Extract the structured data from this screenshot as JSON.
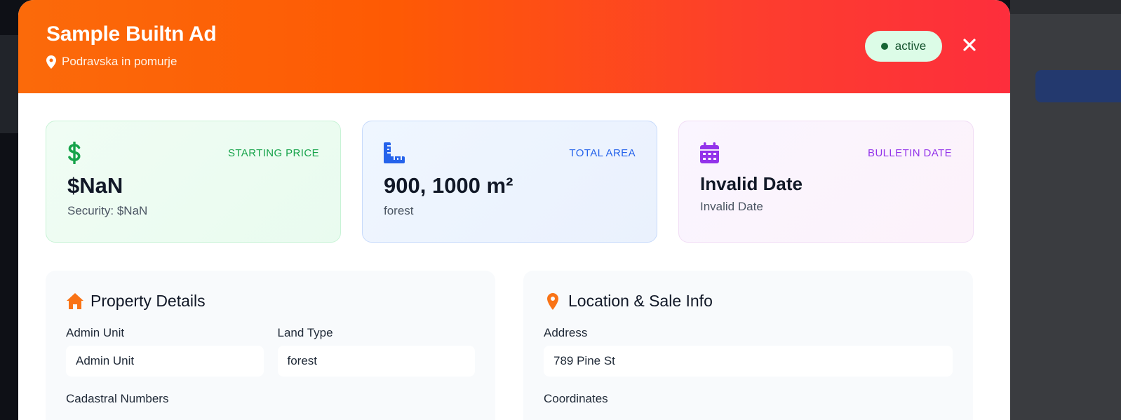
{
  "header": {
    "title": "Sample Builtn Ad",
    "location": "Podravska in pomurje",
    "status": "active",
    "close_icon": "close-icon"
  },
  "stats": [
    {
      "label": "STARTING PRICE",
      "value": "$NaN",
      "sub": "Security: $NaN",
      "icon": "dollar-icon",
      "color": "#16a34a"
    },
    {
      "label": "TOTAL AREA",
      "value": "900, 1000 m²",
      "sub": "forest",
      "icon": "ruler-icon",
      "color": "#2563eb"
    },
    {
      "label": "BULLETIN DATE",
      "value": "Invalid Date",
      "sub": "Invalid Date",
      "icon": "calendar-icon",
      "color": "#9333ea"
    }
  ],
  "property_details": {
    "title": "Property Details",
    "admin_unit_label": "Admin Unit",
    "admin_unit_value": "Admin Unit",
    "land_type_label": "Land Type",
    "land_type_value": "forest",
    "cadastral_label": "Cadastral Numbers"
  },
  "location_sale": {
    "title": "Location & Sale Info",
    "address_label": "Address",
    "address_value": "789 Pine St",
    "coordinates_label": "Coordinates"
  },
  "colors": {
    "accent_orange": "#f97316",
    "status_bg": "#dcfce7",
    "status_text": "#14532d"
  }
}
